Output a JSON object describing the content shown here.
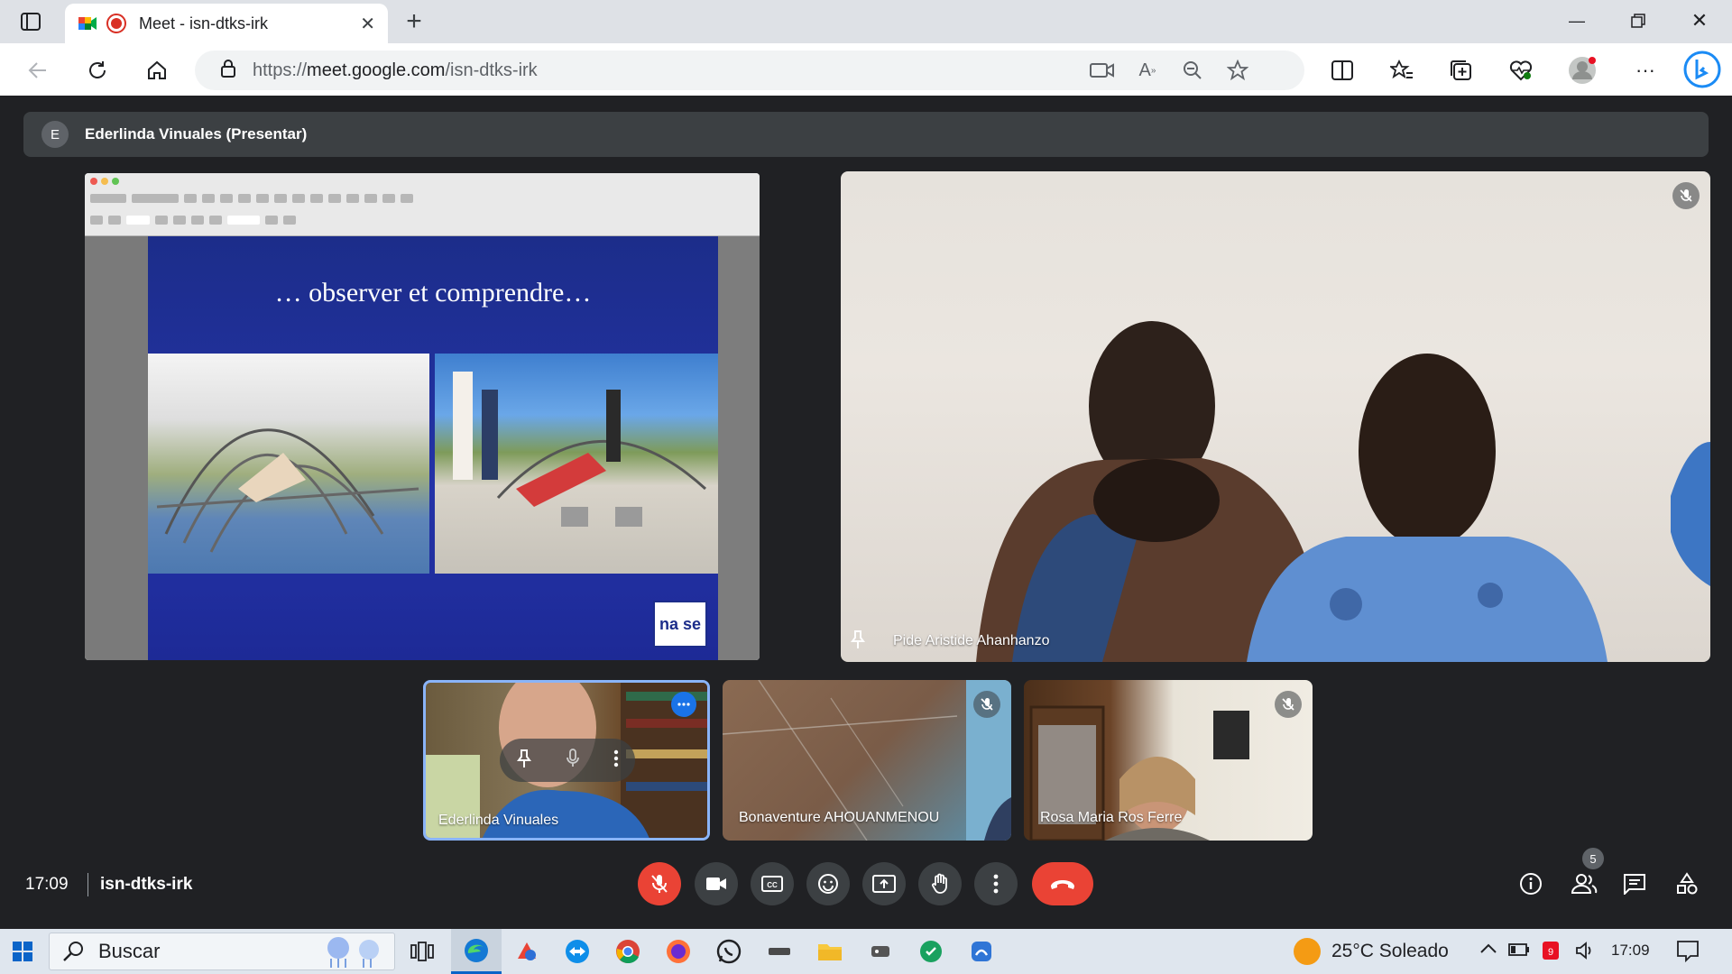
{
  "browser": {
    "tab_title": "Meet - isn-dtks-irk",
    "url_prefix": "https://",
    "url_host": "meet.google.com",
    "url_path": "/isn-dtks-irk"
  },
  "meet": {
    "presenter_initial": "E",
    "presenter_label": "Ederlinda Vinuales (Presentar)",
    "slide_title": "… observer et comprendre…",
    "slide_logo": "na se",
    "pinned_tile_name": "Pide Aristide Ahanhanzo",
    "tiles": [
      {
        "name": "Ederlinda Vinuales"
      },
      {
        "name": "Bonaventure AHOUANMENOU"
      },
      {
        "name": "Rosa Maria Ros Ferre"
      }
    ],
    "clock": "17:09",
    "meeting_code": "isn-dtks-irk",
    "participants_count": "5"
  },
  "taskbar": {
    "search_placeholder": "Buscar",
    "weather": "25°C Soleado",
    "time": "17:09"
  },
  "colors": {
    "meet_bg": "#202124",
    "control_bg": "#3c4043",
    "end_call_red": "#ea4335",
    "active_tile_border": "#8ab4f8",
    "more_button_blue": "#1a73e8"
  }
}
